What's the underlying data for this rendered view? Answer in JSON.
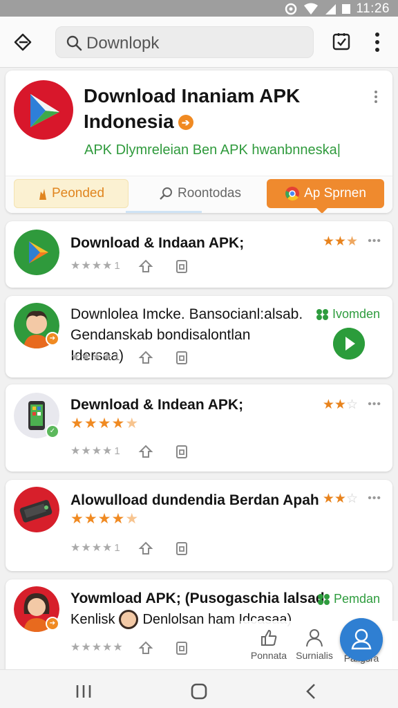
{
  "status": {
    "time": "11:26"
  },
  "search": {
    "query": "Downlopk"
  },
  "hero": {
    "title": "Download Inaniam APK Indonesia",
    "subtitle": "APK Dlymreleian Ben APK hwanbnneska|",
    "tabs": [
      {
        "label": "Peonded",
        "icon": "flame-icon"
      },
      {
        "label": "Roontodas",
        "icon": "search-icon"
      },
      {
        "label": "Ap Sprnen",
        "icon": "chrome-icon"
      }
    ]
  },
  "cards": [
    {
      "title": "Download & Indaan APK;",
      "rating_count": "1",
      "icon": "play-store-icon",
      "top_rating": "3 of 5 stars"
    },
    {
      "title": "Downlolea Imcke. Bansocianl:alsab. Gendanskab bondisalontlan Idersaa)",
      "rating_count": "1",
      "icon": "avatar-icon",
      "tag": "Ivomden"
    },
    {
      "title": "Dewnload & Indean APK;",
      "rating_count": "1",
      "icon": "phone-icon",
      "top_rating": "2 of 5 stars",
      "orange_rating": "4 of 5 stars"
    },
    {
      "title": "Alowulload dundendia Berdan Apah",
      "rating_count": "1",
      "icon": "device-icon",
      "top_rating": "2 of 5 stars",
      "orange_rating": "4 of 5 stars"
    },
    {
      "title": "Yowmload APK; (Pusogaschia lalsad",
      "title2": "Kenlisk",
      "title3": "Denlolsan ham Idcasaa)",
      "icon": "avatar-icon",
      "tag": "Pemdan"
    }
  ],
  "bottom_nav": [
    {
      "label": "Ponnata",
      "icon": "thumb-up-icon"
    },
    {
      "label": "Surnialis",
      "icon": "person-icon"
    },
    {
      "label": "Paligsra",
      "icon": "profile-icon"
    }
  ],
  "colors": {
    "accent": "#f08a22",
    "green": "#2f9a3c",
    "fab": "#2f7fd2"
  }
}
